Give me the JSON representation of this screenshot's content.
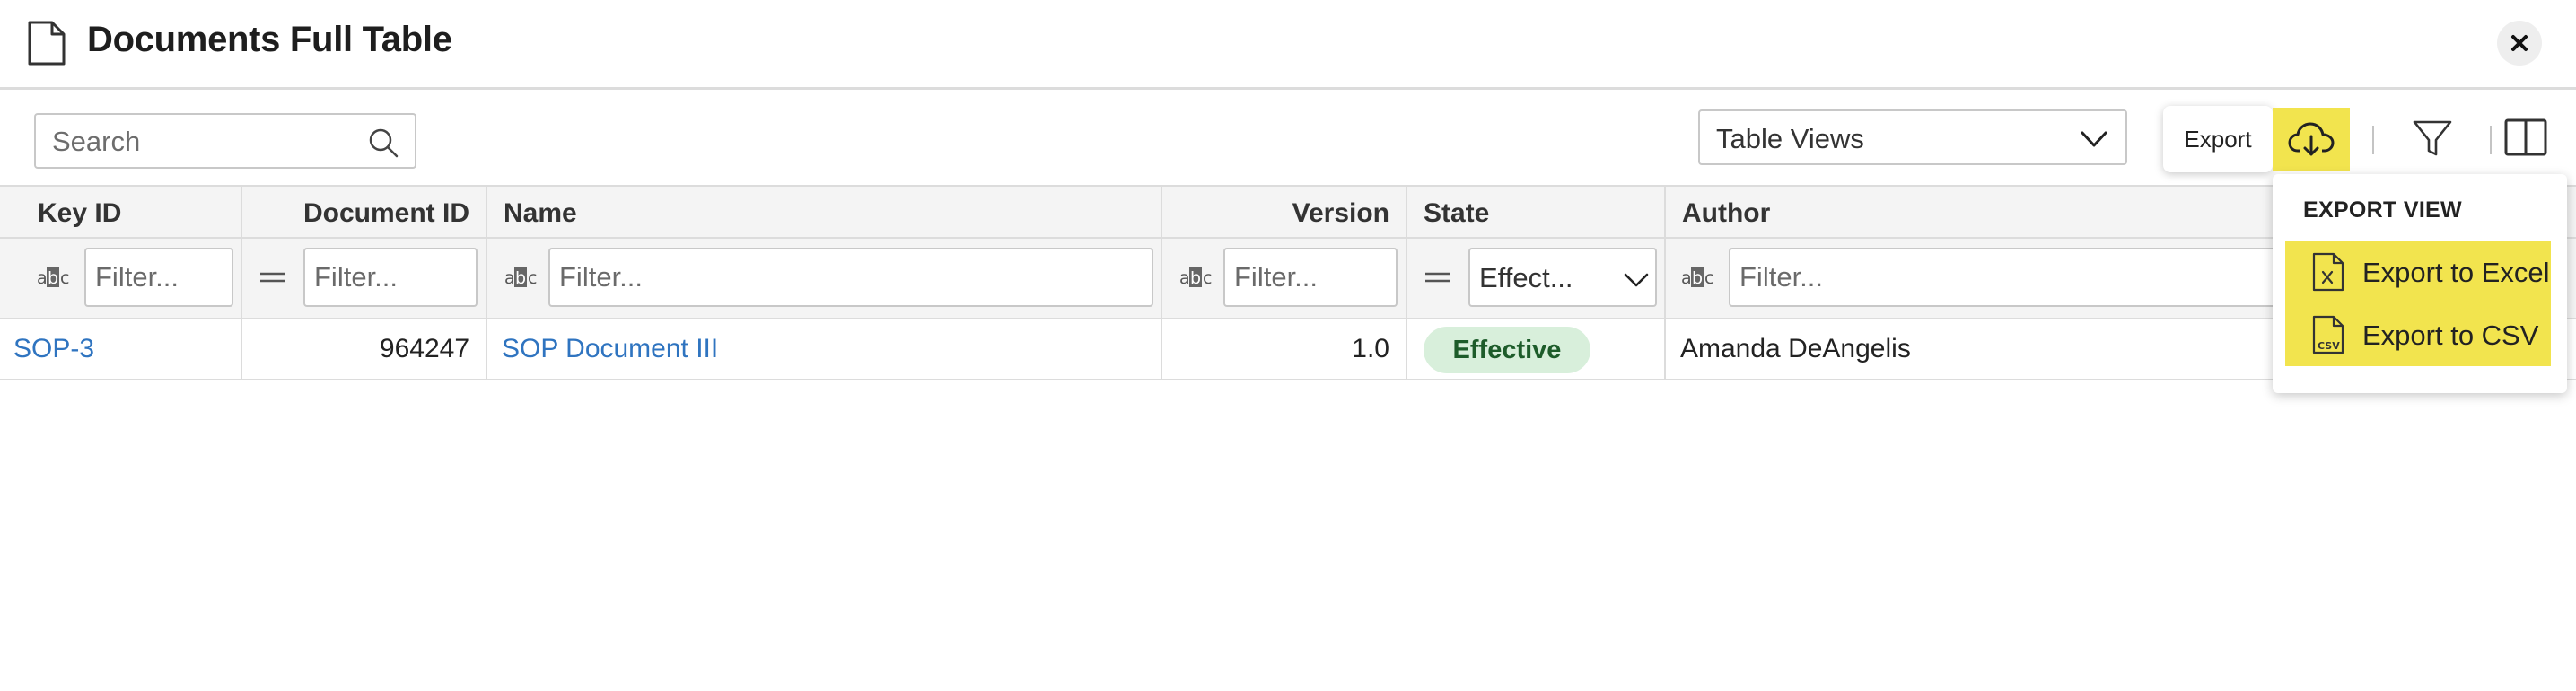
{
  "header": {
    "title": "Documents Full Table",
    "icon": "document-icon",
    "close_icon": "close-icon"
  },
  "toolbar": {
    "search_placeholder": "Search",
    "table_views_label": "Table Views",
    "export_tooltip": "Export",
    "export_icon": "cloud-download-icon",
    "filter_icon": "funnel-icon",
    "columns_icon": "columns-icon",
    "export_highlight_color": "#f2e44e"
  },
  "table": {
    "columns": [
      "Key ID",
      "Document ID",
      "Name",
      "Version",
      "State",
      "Author"
    ],
    "filter_placeholder": "Filter...",
    "state_filter_value": "Effect...",
    "rows": [
      {
        "key_id": "SOP-3",
        "document_id": "964247",
        "name": "SOP Document III",
        "version": "1.0",
        "state": "Effective",
        "author": "Amanda DeAngelis"
      }
    ],
    "link_color": "#2f74c0",
    "effective_badge_color": "#d8efdb"
  },
  "export_menu": {
    "title": "EXPORT VIEW",
    "items": [
      {
        "label": "Export to Excel",
        "icon": "excel-file-icon"
      },
      {
        "label": "Export to CSV",
        "icon": "csv-file-icon"
      }
    ]
  }
}
